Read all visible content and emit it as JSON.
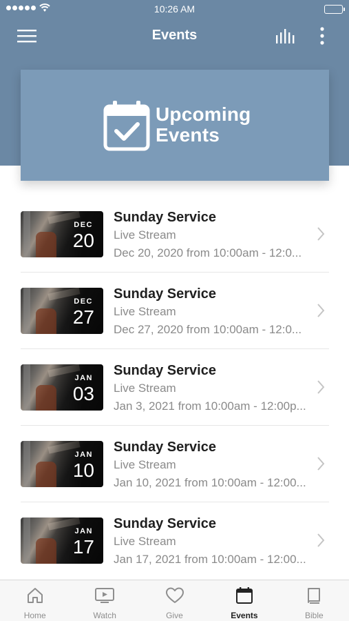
{
  "status_bar": {
    "time": "10:26 AM"
  },
  "nav": {
    "title": "Events"
  },
  "hero": {
    "line1": "Upcoming",
    "line2": "Events"
  },
  "events": [
    {
      "month": "DEC",
      "day": "20",
      "title": "Sunday Service",
      "subtitle": "Live Stream",
      "date_text": "Dec 20, 2020 from 10:00am - 12:0..."
    },
    {
      "month": "DEC",
      "day": "27",
      "title": "Sunday Service",
      "subtitle": "Live Stream",
      "date_text": "Dec 27, 2020 from 10:00am - 12:0..."
    },
    {
      "month": "JAN",
      "day": "03",
      "title": "Sunday Service",
      "subtitle": "Live Stream",
      "date_text": "Jan 3, 2021 from 10:00am - 12:00p..."
    },
    {
      "month": "JAN",
      "day": "10",
      "title": "Sunday Service",
      "subtitle": "Live Stream",
      "date_text": "Jan 10, 2021 from 10:00am - 12:00..."
    },
    {
      "month": "JAN",
      "day": "17",
      "title": "Sunday Service",
      "subtitle": "Live Stream",
      "date_text": "Jan 17, 2021 from 10:00am - 12:00..."
    }
  ],
  "tabs": [
    {
      "label": "Home",
      "icon": "home-icon"
    },
    {
      "label": "Watch",
      "icon": "tv-icon"
    },
    {
      "label": "Give",
      "icon": "heart-icon"
    },
    {
      "label": "Events",
      "icon": "calendar-icon",
      "active": true
    },
    {
      "label": "Bible",
      "icon": "book-icon"
    }
  ],
  "colors": {
    "header": "#6b88a4",
    "hero": "#7c9bb8",
    "active_tab": "#222222",
    "inactive_tab": "#8e8e8e"
  }
}
